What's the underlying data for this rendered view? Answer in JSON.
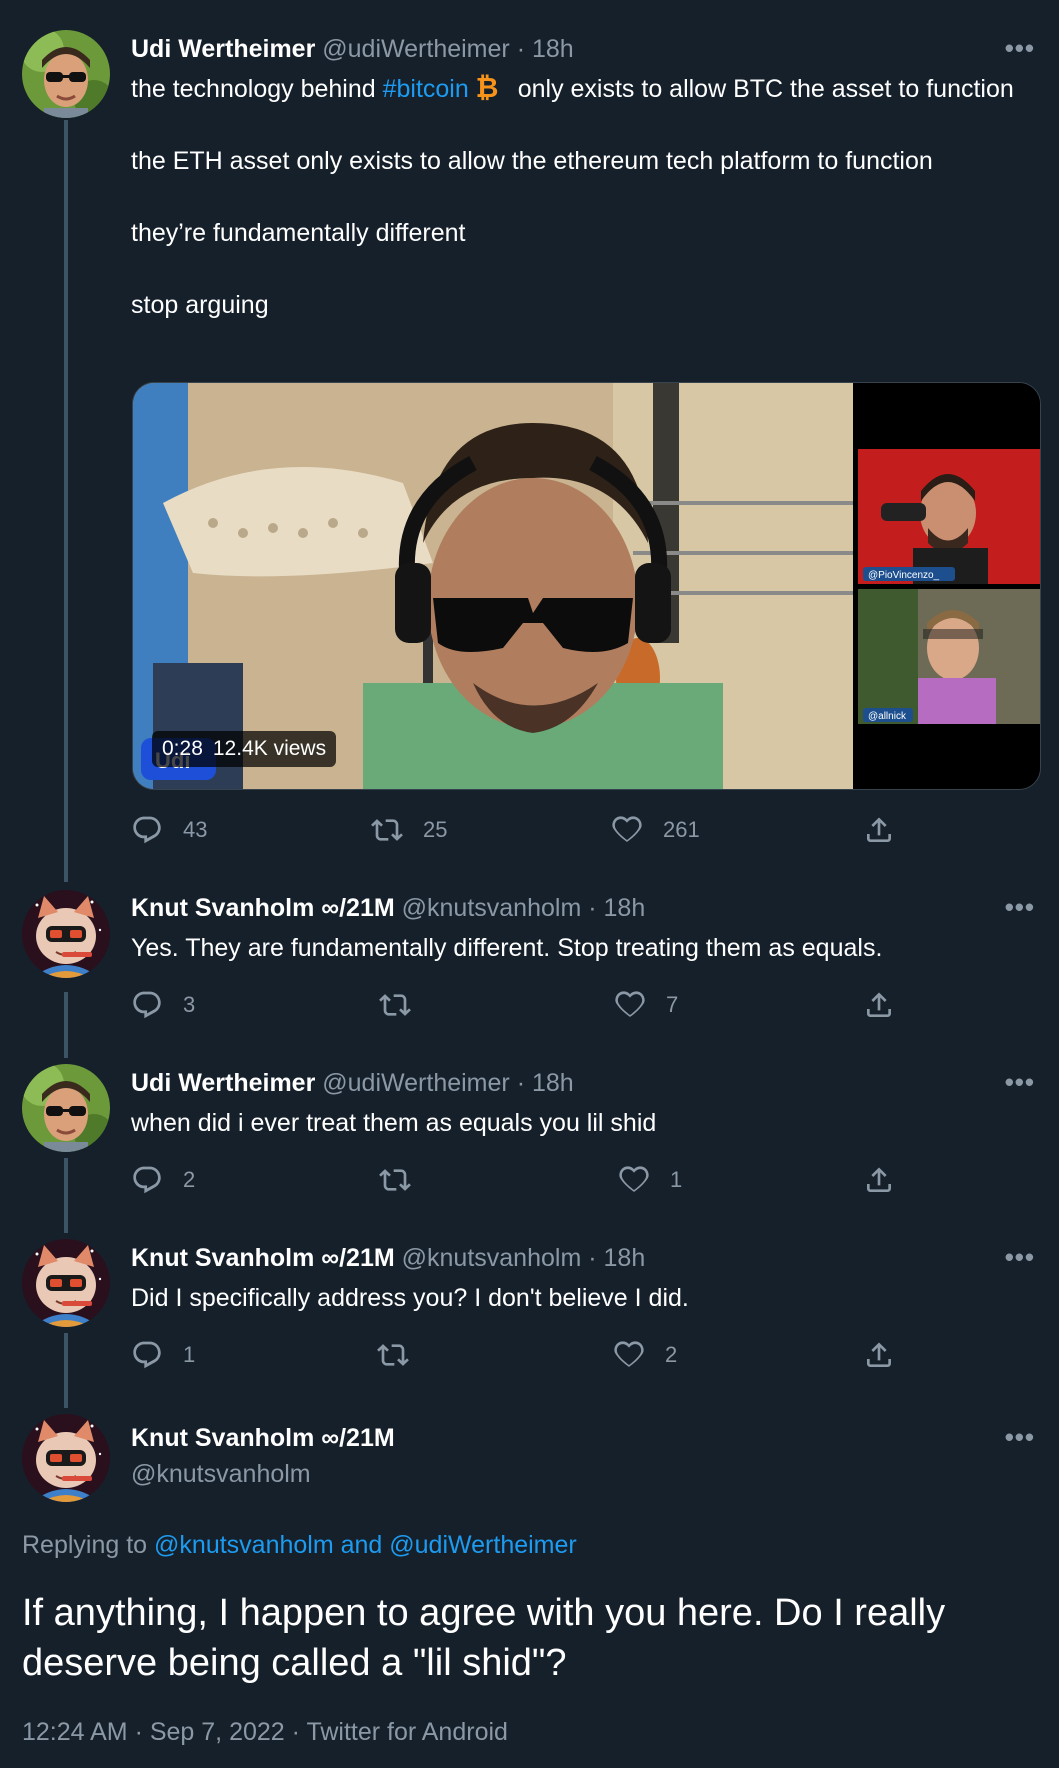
{
  "tweets": [
    {
      "name": "Udi Wertheimer",
      "handle": "@udiWertheimer",
      "time": "· 18h",
      "text_before_tag": "the technology behind ",
      "hashtag": "#bitcoin",
      "text_after_tag": " only exists to allow BTC the asset to function",
      "para2": "the ETH asset only exists to allow the ethereum tech platform to function",
      "para3": "they’re fundamentally different",
      "para4": "stop arguing",
      "video": {
        "duration": "0:28",
        "views": "12.4K views",
        "label_top": "@PioVincenzo_",
        "label_bottom": "@allnick",
        "name_tag": "Udi"
      },
      "replies": "43",
      "retweets": "25",
      "likes": "261"
    },
    {
      "name": "Knut Svanholm ∞/21M",
      "handle": "@knutsvanholm",
      "time": "· 18h",
      "text": "Yes. They are fundamentally different. Stop treating them as equals.",
      "replies": "3",
      "retweets": "",
      "likes": "7"
    },
    {
      "name": "Udi Wertheimer",
      "handle": "@udiWertheimer",
      "time": "· 18h",
      "text": "when did i ever treat them as equals you lil shid",
      "replies": "2",
      "retweets": "",
      "likes": "1"
    },
    {
      "name": "Knut Svanholm ∞/21M",
      "handle": "@knutsvanholm",
      "time": "· 18h",
      "text": "Did I specifically address you? I don't believe I did.",
      "replies": "1",
      "retweets": "",
      "likes": "2"
    }
  ],
  "focused": {
    "name": "Knut Svanholm ∞/21M",
    "handle": "@knutsvanholm",
    "replying_prefix": "Replying to ",
    "replying_to": "@knutsvanholm and @udiWertheimer",
    "text": "If anything, I happen to agree with you here. Do I really deserve being called a \"lil shid\"?",
    "meta": "12:24 AM · Sep 7, 2022 · Twitter for Android"
  },
  "more_label": "•••",
  "colors": {
    "background": "#15202b",
    "link": "#1d9bf0",
    "muted": "#8b98a5",
    "bitcoin": "#f7931a"
  },
  "icons": [
    "reply-icon",
    "retweet-icon",
    "like-icon",
    "share-icon",
    "more-icon",
    "bitcoin-icon"
  ]
}
